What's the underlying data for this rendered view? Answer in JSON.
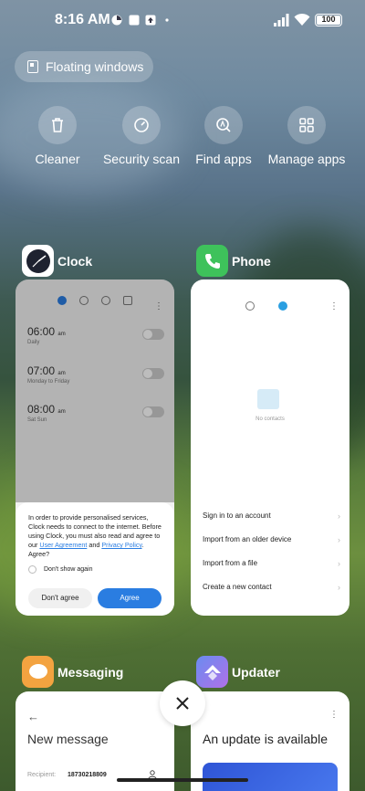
{
  "status_bar": {
    "time": "8:16 AM",
    "battery": "100"
  },
  "floating_windows": {
    "label": "Floating windows"
  },
  "tools": [
    {
      "label": "Cleaner",
      "icon": "trash-icon"
    },
    {
      "label": "Security scan",
      "icon": "shield-gauge-icon"
    },
    {
      "label": "Find apps",
      "icon": "find-apps-icon"
    },
    {
      "label": "Manage apps",
      "icon": "grid-icon"
    }
  ],
  "apps": {
    "clock": {
      "name": "Clock",
      "alarms": [
        {
          "time": "06:00",
          "ampm": "am",
          "sub": "Daily"
        },
        {
          "time": "07:00",
          "ampm": "am",
          "sub": "Monday to Friday"
        },
        {
          "time": "08:00",
          "ampm": "am",
          "sub": "Sat Sun"
        }
      ],
      "dialog": {
        "text_1": "In order to provide personalised services, Clock needs to connect to the internet. Before using Clock, you must also read and agree to our",
        "link_1": "User Agreement",
        "text_and": "and",
        "link_2": "Privacy Policy",
        "text_end": ". Agree?",
        "checkbox": "Don't show again",
        "dont_agree": "Don't agree",
        "agree": "Agree"
      }
    },
    "phone": {
      "name": "Phone",
      "empty": "No contacts",
      "items": [
        "Sign in to an account",
        "Import from an older device",
        "Import from a file",
        "Create a new contact"
      ]
    },
    "messaging": {
      "name": "Messaging",
      "title": "New message",
      "recipient_label": "Recipient:",
      "recipient_value": "18730218809"
    },
    "updater": {
      "name": "Updater",
      "title": "An update is available"
    }
  }
}
